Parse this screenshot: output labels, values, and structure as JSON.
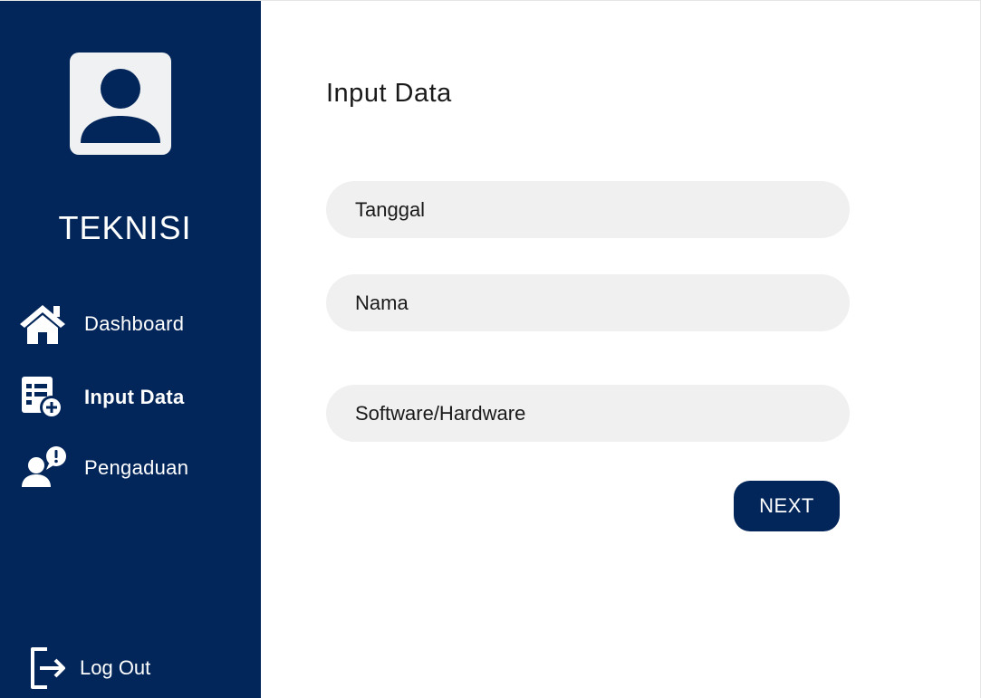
{
  "sidebar": {
    "role": "TEKNISI",
    "items": [
      {
        "label": "Dashboard",
        "icon": "home-icon",
        "active": false
      },
      {
        "label": "Input Data",
        "icon": "add-data-icon",
        "active": true
      },
      {
        "label": "Pengaduan",
        "icon": "user-complaint-icon",
        "active": false
      }
    ],
    "logout_label": "Log Out"
  },
  "main": {
    "title": "Input Data",
    "fields": {
      "tanggal_placeholder": "Tanggal",
      "nama_placeholder": "Nama",
      "software_hardware_placeholder": "Software/Hardware"
    },
    "next_label": "NEXT"
  },
  "colors": {
    "primary": "#03265a",
    "field_bg": "#f0f0f0",
    "avatar_bg": "#f0f1f3"
  }
}
